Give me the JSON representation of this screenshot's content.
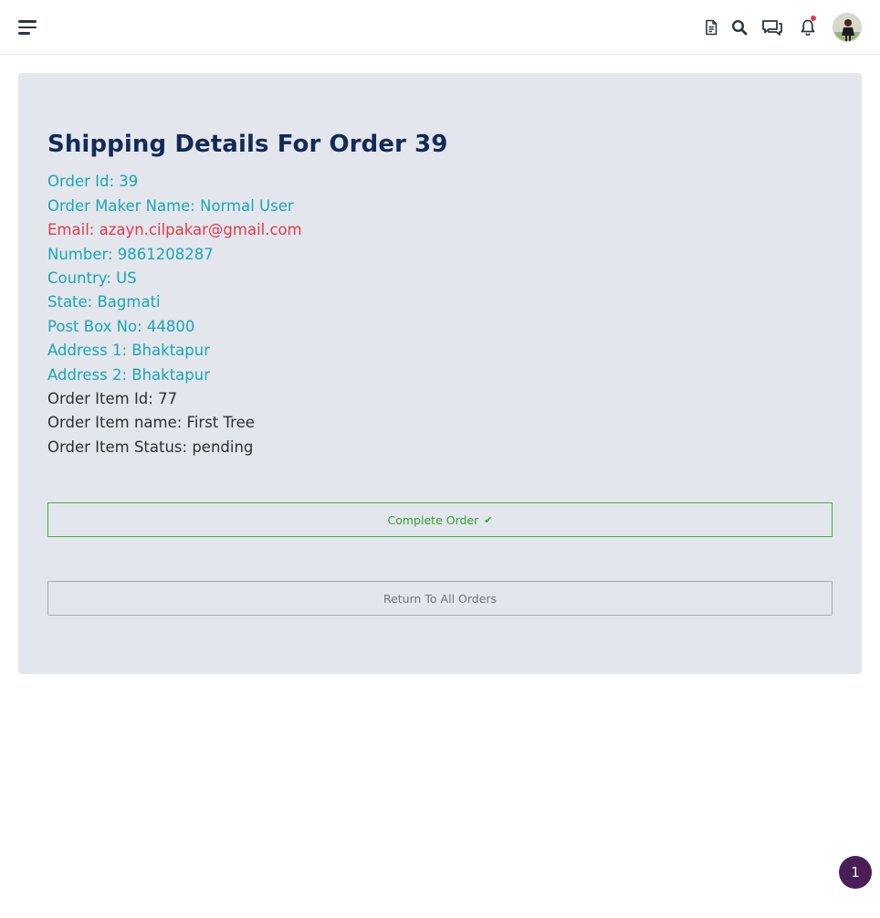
{
  "topbar": {
    "icons": {
      "menu": "menu-icon",
      "document": "document-icon",
      "search": "search-icon",
      "chat": "chat-icon",
      "notifications": "bell-icon",
      "avatar": "user-avatar"
    },
    "notification_dot_color": "#e23b4c"
  },
  "page": {
    "title": "Shipping Details For Order 39"
  },
  "details": {
    "order_id": "Order Id: 39",
    "order_maker": "Order Maker Name: Normal User",
    "email": "Email: azayn.cilpakar@gmail.com",
    "number": "Number: 9861208287",
    "country": "Country: US",
    "state": "State: Bagmati",
    "post_box": "Post Box No: 44800",
    "address1": "Address 1: Bhaktapur",
    "address2": "Address 2: Bhaktapur",
    "item_id": "Order Item Id: 77",
    "item_name": "Order Item name: First Tree",
    "item_status": "Order Item Status: pending"
  },
  "actions": {
    "complete_label": "Complete Order",
    "complete_icon": "✔",
    "return_label": "Return To All Orders"
  },
  "floating_badge": {
    "value": "1"
  },
  "colors": {
    "title": "#122a56",
    "teal_text": "#1aa7b6",
    "email_text": "#e23b4c",
    "complete_border": "#3eb13e",
    "badge_bg": "#4a1f57"
  }
}
